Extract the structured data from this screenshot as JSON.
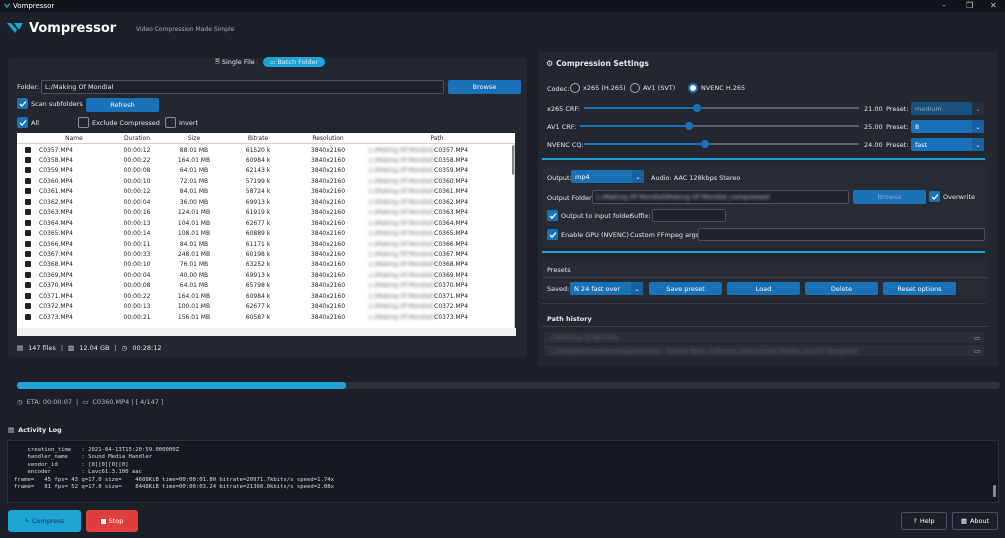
{
  "window": {
    "title": "Vompressor",
    "min": "–",
    "max": "❐",
    "close": "✕"
  },
  "header": {
    "title": "Vompressor",
    "subtitle": "Video Compression Made Simple"
  },
  "mode_tabs": {
    "single": "Single File",
    "batch": "Batch Folder"
  },
  "batch": {
    "folder_label": "Folder:",
    "folder_value": "L:/Making Of Mondial",
    "browse": "Browse",
    "scan_subfolders": "Scan subfolders",
    "refresh": "Refresh",
    "all": "All",
    "exclude_compressed": "Exclude Compressed",
    "invert": "Invert",
    "columns": [
      "Name",
      "Duration",
      "Size",
      "Bitrate",
      "Resolution",
      "Path"
    ],
    "rows": [
      [
        "C0357.MP4",
        "00:00:12",
        "88.01 MB",
        "61520 k",
        "3840x2160",
        "L:\\Making Of Mondial\\",
        "C0357.MP4"
      ],
      [
        "C0358.MP4",
        "00:00:22",
        "164.01 MB",
        "60984 k",
        "3840x2160",
        "L:\\Making Of Mondial\\",
        "C0358.MP4"
      ],
      [
        "C0359.MP4",
        "00:00:08",
        "64.01 MB",
        "62143 k",
        "3840x2160",
        "L:\\Making Of Mondial\\",
        "C0359.MP4"
      ],
      [
        "C0360.MP4",
        "00:00:10",
        "72.01 MB",
        "57199 k",
        "3840x2160",
        "L:\\Making Of Mondial\\",
        "C0360.MP4"
      ],
      [
        "C0361.MP4",
        "00:00:12",
        "84.01 MB",
        "58724 k",
        "3840x2160",
        "L:\\Making Of Mondial\\",
        "C0361.MP4"
      ],
      [
        "C0362.MP4",
        "00:00:04",
        "36.00 MB",
        "69913 k",
        "3840x2160",
        "L:\\Making Of Mondial\\",
        "C0362.MP4"
      ],
      [
        "C0363.MP4",
        "00:00:16",
        "124.01 MB",
        "61919 k",
        "3840x2160",
        "L:\\Making Of Mondial\\",
        "C0363.MP4"
      ],
      [
        "C0364.MP4",
        "00:00:13",
        "104.01 MB",
        "62677 k",
        "3840x2160",
        "L:\\Making Of Mondial\\",
        "C0364.MP4"
      ],
      [
        "C0365.MP4",
        "00:00:14",
        "108.01 MB",
        "60889 k",
        "3840x2160",
        "L:\\Making Of Mondial\\",
        "C0365.MP4"
      ],
      [
        "C0366.MP4",
        "00:00:11",
        "84.01 MB",
        "61171 k",
        "3840x2160",
        "L:\\Making Of Mondial\\",
        "C0366.MP4"
      ],
      [
        "C0367.MP4",
        "00:00:33",
        "248.01 MB",
        "60198 k",
        "3840x2160",
        "L:\\Making Of Mondial\\",
        "C0367.MP4"
      ],
      [
        "C0368.MP4",
        "00:00:10",
        "76.01 MB",
        "63252 k",
        "3840x2160",
        "L:\\Making Of Mondial\\",
        "C0368.MP4"
      ],
      [
        "C0369.MP4",
        "00:00:04",
        "40.00 MB",
        "69913 k",
        "3840x2160",
        "L:\\Making Of Mondial\\",
        "C0369.MP4"
      ],
      [
        "C0370.MP4",
        "00:00:08",
        "64.01 MB",
        "65798 k",
        "3840x2160",
        "L:\\Making Of Mondial\\",
        "C0370.MP4"
      ],
      [
        "C0371.MP4",
        "00:00:22",
        "164.01 MB",
        "60984 k",
        "3840x2160",
        "L:\\Making Of Mondial\\",
        "C0371.MP4"
      ],
      [
        "C0372.MP4",
        "00:00:13",
        "100.01 MB",
        "62677 k",
        "3840x2160",
        "L:\\Making Of Mondial\\",
        "C0372.MP4"
      ],
      [
        "C0373.MP4",
        "00:00:21",
        "156.01 MB",
        "60587 k",
        "3840x2160",
        "L:\\Making Of Mondial\\",
        "C0373.MP4"
      ]
    ],
    "footer": {
      "files": "147 files",
      "size": "12.04 GB",
      "duration": "00:28:12"
    }
  },
  "settings": {
    "title": "Compression Settings",
    "codec_label": "Codec:",
    "codecs": [
      "x265 (H.265)",
      "AV1 (SVT)",
      "NVENC H.265"
    ],
    "x265": {
      "label": "x265 CRF:",
      "value": "21.00",
      "fraction": 0.41,
      "preset_label": "Preset:",
      "preset": "medium"
    },
    "av1": {
      "label": "AV1 CRF:",
      "value": "25.00",
      "fraction": 0.39,
      "preset_label": "Preset:",
      "preset": "8"
    },
    "nvenc": {
      "label": "NVENC CQ:",
      "value": "24.00",
      "fraction": 0.44,
      "preset_label": "Preset:",
      "preset": "fast"
    },
    "output_label": "Output:",
    "output_format": "mp4",
    "audio": "Audio: AAC 128kbps Stereo",
    "output_folder_label": "Output Folder:",
    "output_folder_value": "L:\\Making Of Mondial\\Making Of Mondial_compressed",
    "browse": "Browse",
    "overwrite": "Overwrite",
    "output_to_input": "Output to input folder",
    "suffix_label": "Suffix:",
    "gpu": "Enable GPU (NVENC)",
    "custom_args": "Custom FFmpeg args:",
    "presets_title": "Presets",
    "saved_label": "Saved:",
    "saved_value": "N 24 fast over",
    "save_preset": "Save preset",
    "load": "Load",
    "delete": "Delete",
    "reset": "Reset options",
    "history_title": "Path history",
    "history": [
      "L:\\Making Of Mondial",
      "L:\\Projects\\Drone\\Footage\\Archive - Sound Team Software and Sounds Studio and 47 Vanguard"
    ]
  },
  "progress": {
    "fraction": 0.335,
    "eta": "ETA: 00:00:07",
    "current": "C0360.MP4 | [ 4/147 ]"
  },
  "log": {
    "title": "Activity Log",
    "lines": [
      "    creation_time   : 2021-04-13T15:20:59.000000Z",
      "    handler_name    : Sound Media Handler",
      "    vendor_id       : [0][0][0][0]",
      "    encoder         : Lavc61.3.100 aac",
      "frame=   45 fps= 43 q=17.0 size=    4608KiB time=00:00:01.80 bitrate=20971.7kbits/s speed=1.74x",
      "frame=   81 fps= 52 q=17.0 size=    8448KiB time=00:00:03.24 bitrate=21360.0kbits/s speed=2.08x"
    ]
  },
  "actions": {
    "compress": "Compress",
    "stop": "Stop",
    "help": "Help",
    "about": "About"
  },
  "colors": {
    "accent": "#1971b8",
    "cyan": "#1fa3d6",
    "compress": "#1ea5d4",
    "stop": "#e0403d"
  }
}
